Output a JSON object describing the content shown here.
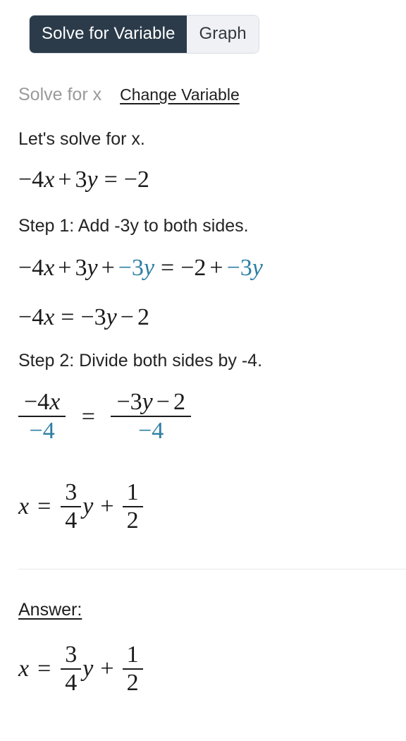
{
  "tabs": [
    {
      "label": "Solve for Variable",
      "active": true
    },
    {
      "label": "Graph",
      "active": false
    }
  ],
  "header": {
    "solve_label": "Solve for x",
    "change_variable_label": "Change Variable"
  },
  "colors": {
    "active_tab_bg": "#2b3b4a",
    "inactive_tab_bg": "#eff1f4",
    "highlight_blue": "#2e7fa4",
    "body_text": "#242424",
    "muted_text": "#9a9a9a"
  },
  "work": {
    "intro": "Let's solve for x.",
    "equation_0": {
      "t1": "−4",
      "v1": "x",
      "op1": "+",
      "t2": "3",
      "v2": "y",
      "eq": "=",
      "rhs": "−2"
    },
    "step1_text": "Step 1: Add -3y to both sides.",
    "equation_1": {
      "t1": "−4",
      "v1": "x",
      "op1": "+",
      "t2": "3",
      "v2": "y",
      "op2": "+",
      "hl1_num": "−3",
      "hl1_var": "y",
      "eq": "=",
      "rhs": "−2",
      "op3": "+",
      "hl2_num": "−3",
      "hl2_var": "y"
    },
    "equation_2": {
      "t1": "−4",
      "v1": "x",
      "eq": "=",
      "t2": "−3",
      "v2": "y",
      "op": "−",
      "t3": "2"
    },
    "step2_text": "Step 2: Divide both sides by -4.",
    "equation_3": {
      "left_num_coeff": "−4",
      "left_num_var": "x",
      "left_den": "−4",
      "eq": "=",
      "right_num_a": "−3",
      "right_num_var": "y",
      "right_num_op": "−",
      "right_num_b": "2",
      "right_den": "−4"
    },
    "equation_4": {
      "lhs": "x",
      "eq": "=",
      "f1_top": "3",
      "f1_bot": "4",
      "f1_var": "y",
      "op": "+",
      "f2_top": "1",
      "f2_bot": "2"
    }
  },
  "answer": {
    "label": "Answer:",
    "equation": {
      "lhs": "x",
      "eq": "=",
      "f1_top": "3",
      "f1_bot": "4",
      "f1_var": "y",
      "op": "+",
      "f2_top": "1",
      "f2_bot": "2"
    }
  }
}
